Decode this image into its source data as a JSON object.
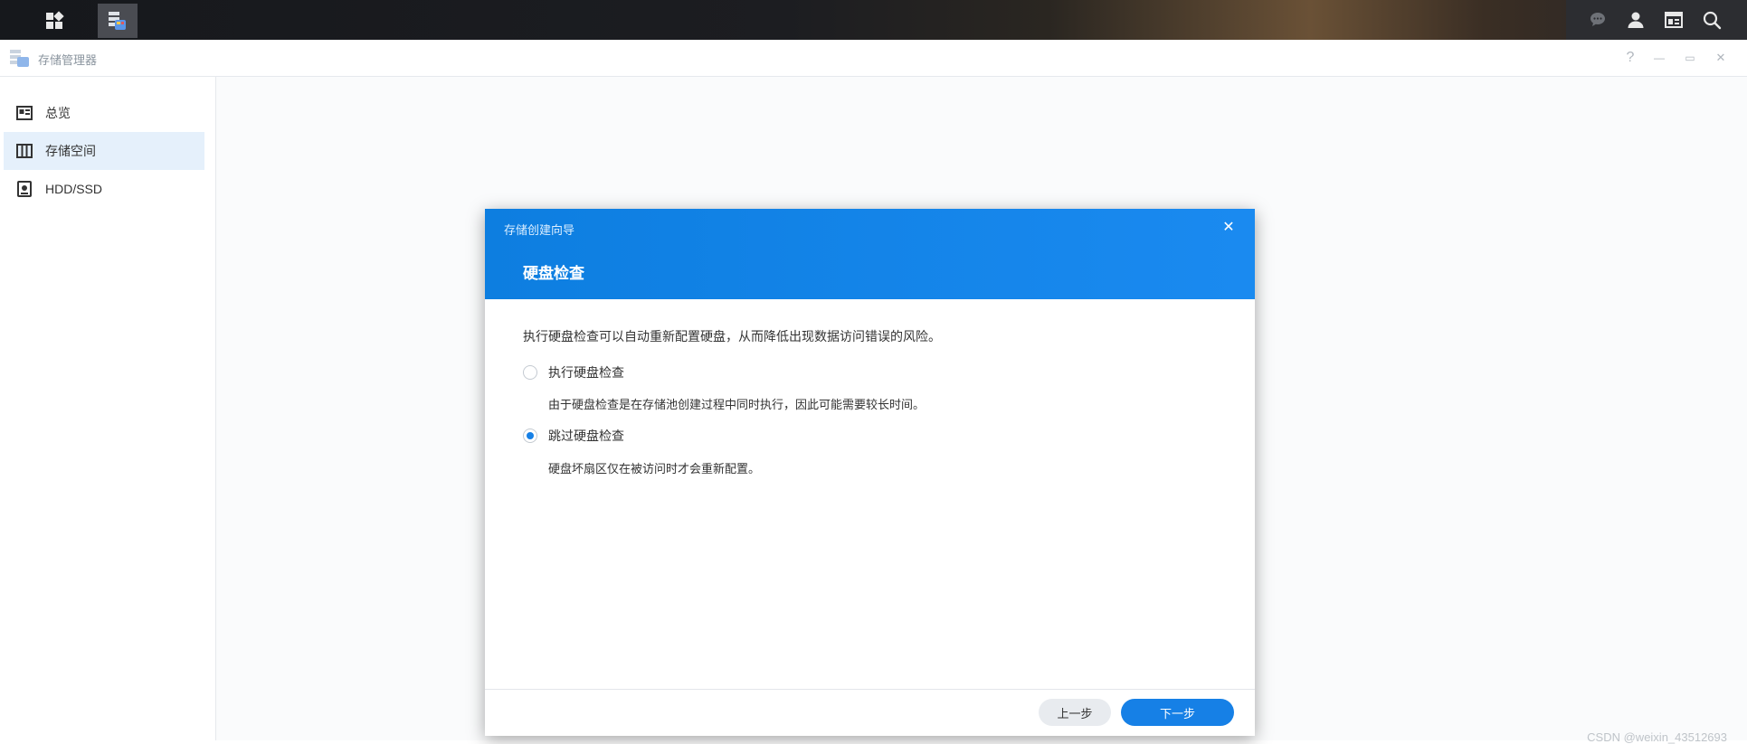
{
  "app": {
    "title": "存储管理器"
  },
  "taskbar": {
    "left_buttons": [
      "main-menu-icon",
      "storage-manager-app-icon"
    ],
    "right_icons": [
      "chat-icon",
      "user-icon",
      "widgets-icon",
      "search-icon"
    ]
  },
  "window_controls": [
    "help-icon",
    "minimize-icon",
    "restore-icon",
    "close-icon"
  ],
  "window_controls_text": {
    "help": "?",
    "minimize": "—",
    "restore": "▭",
    "close": "✕"
  },
  "sidebar": {
    "items": [
      {
        "label": "总览",
        "icon": "overview-icon",
        "active": false
      },
      {
        "label": "存储空间",
        "icon": "storage-icon",
        "active": true
      },
      {
        "label": "HDD/SSD",
        "icon": "disk-icon",
        "active": false
      }
    ]
  },
  "dialog": {
    "wizard_title": "存储创建向导",
    "step_title": "硬盘检查",
    "close_glyph": "✕",
    "description": "执行硬盘检查可以自动重新配置硬盘，从而降低出现数据访问错误的风险。",
    "options": [
      {
        "label": "执行硬盘检查",
        "hint": "由于硬盘检查是在存储池创建过程中同时执行，因此可能需要较长时间。",
        "checked": false
      },
      {
        "label": "跳过硬盘检查",
        "hint": "硬盘坏扇区仅在被访问时才会重新配置。",
        "checked": true
      }
    ],
    "buttons": {
      "prev": "上一步",
      "next": "下一步"
    }
  },
  "watermark": "CSDN @weixin_43512693",
  "colors": {
    "accent": "#1680e6",
    "header_blue": "#0d7ee0",
    "sidebar_active": "#e5f0fb"
  }
}
